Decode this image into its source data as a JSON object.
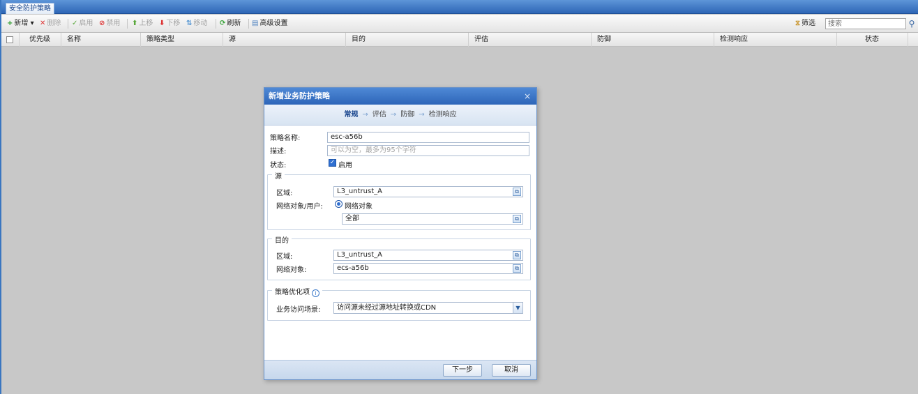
{
  "tabs": [
    {
      "label": "安全防护策略"
    }
  ],
  "toolbar": {
    "new_label": "新增",
    "delete_label": "删除",
    "enable_label": "启用",
    "disable_label": "禁用",
    "up_label": "上移",
    "down_label": "下移",
    "move_label": "移动",
    "refresh_label": "刷新",
    "advanced_label": "高级设置",
    "filter_label": "筛选",
    "search_placeholder": "搜索"
  },
  "grid": {
    "columns": [
      "优先级",
      "名称",
      "策略类型",
      "源",
      "目的",
      "评估",
      "防御",
      "检测响应",
      "状态"
    ]
  },
  "dialog": {
    "title": "新增业务防护策略",
    "close": "×",
    "steps": [
      "常规",
      "评估",
      "防御",
      "检测响应"
    ],
    "step_arrow": "→",
    "policy_name_label": "策略名称:",
    "policy_name_value": "esc-a56b",
    "desc_label": "描述:",
    "desc_placeholder": "可以为空，最多为95个字符",
    "status_label": "状态:",
    "status_checkbox_label": "启用",
    "source": {
      "legend": "源",
      "zone_label": "区域:",
      "zone_value": "L3_untrust_A",
      "net_obj_user_label": "网络对象/用户:",
      "radio_label": "网络对象",
      "net_obj_value": "全部"
    },
    "destination": {
      "legend": "目的",
      "zone_label": "区域:",
      "zone_value": "L3_untrust_A",
      "net_obj_label": "网络对象:",
      "net_obj_value": "ecs-a56b"
    },
    "optimization": {
      "legend": "策略优化项",
      "scene_label": "业务访问场景:",
      "scene_value": "访问源未经过源地址转换或CDN"
    },
    "next_button": "下一步",
    "cancel_button": "取消"
  },
  "colors": {
    "accent": "#2e66b6",
    "title_bar": "#3a76c8"
  }
}
